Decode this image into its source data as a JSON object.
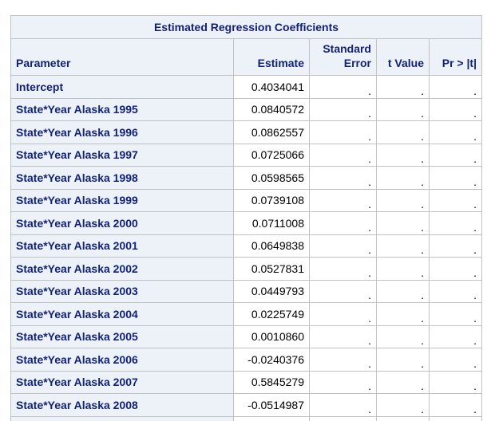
{
  "table": {
    "title": "Estimated Regression Coefficients",
    "columns": {
      "parameter": "Parameter",
      "estimate": "Estimate",
      "std_error_line1": "Standard",
      "std_error_line2": "Error",
      "t_value": "t Value",
      "pr_t": "Pr > |t|"
    },
    "rows": [
      {
        "parameter": "Intercept",
        "estimate": "0.4034041",
        "std_error": ".",
        "t_value": ".",
        "pr_t": "."
      },
      {
        "parameter": "State*Year Alaska 1995",
        "estimate": "0.0840572",
        "std_error": ".",
        "t_value": ".",
        "pr_t": "."
      },
      {
        "parameter": "State*Year Alaska 1996",
        "estimate": "0.0862557",
        "std_error": ".",
        "t_value": ".",
        "pr_t": "."
      },
      {
        "parameter": "State*Year Alaska 1997",
        "estimate": "0.0725066",
        "std_error": ".",
        "t_value": ".",
        "pr_t": "."
      },
      {
        "parameter": "State*Year Alaska 1998",
        "estimate": "0.0598565",
        "std_error": ".",
        "t_value": ".",
        "pr_t": "."
      },
      {
        "parameter": "State*Year Alaska 1999",
        "estimate": "0.0739108",
        "std_error": ".",
        "t_value": ".",
        "pr_t": "."
      },
      {
        "parameter": "State*Year Alaska 2000",
        "estimate": "0.0711008",
        "std_error": ".",
        "t_value": ".",
        "pr_t": "."
      },
      {
        "parameter": "State*Year Alaska 2001",
        "estimate": "0.0649838",
        "std_error": ".",
        "t_value": ".",
        "pr_t": "."
      },
      {
        "parameter": "State*Year Alaska 2002",
        "estimate": "0.0527831",
        "std_error": ".",
        "t_value": ".",
        "pr_t": "."
      },
      {
        "parameter": "State*Year Alaska 2003",
        "estimate": "0.0449793",
        "std_error": ".",
        "t_value": ".",
        "pr_t": "."
      },
      {
        "parameter": "State*Year Alaska 2004",
        "estimate": "0.0225749",
        "std_error": ".",
        "t_value": ".",
        "pr_t": "."
      },
      {
        "parameter": "State*Year Alaska 2005",
        "estimate": "0.0010860",
        "std_error": ".",
        "t_value": ".",
        "pr_t": "."
      },
      {
        "parameter": "State*Year Alaska 2006",
        "estimate": "-0.0240376",
        "std_error": ".",
        "t_value": ".",
        "pr_t": "."
      },
      {
        "parameter": "State*Year Alaska 2007",
        "estimate": "0.5845279",
        "std_error": ".",
        "t_value": ".",
        "pr_t": "."
      },
      {
        "parameter": "State*Year Alaska 2008",
        "estimate": "-0.0514987",
        "std_error": ".",
        "t_value": ".",
        "pr_t": "."
      }
    ]
  }
}
